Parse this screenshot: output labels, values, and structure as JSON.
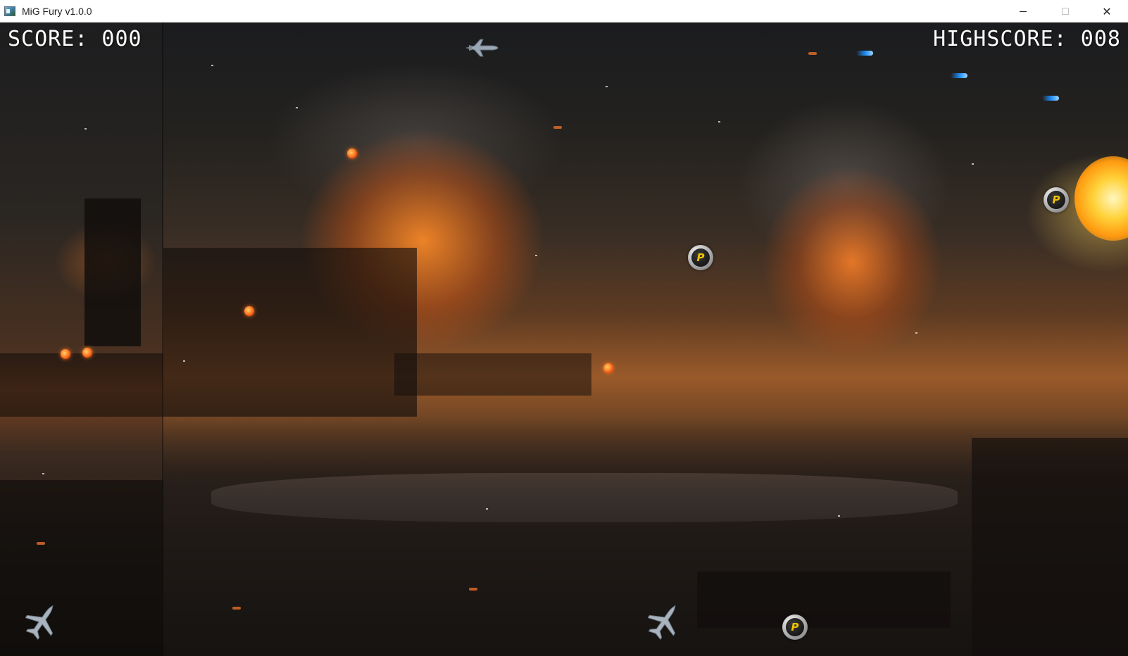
{
  "window": {
    "title": "MiG Fury v1.0.0",
    "controls": {
      "minimize": "minimize",
      "maximize": "maximize",
      "close": "✕"
    }
  },
  "hud": {
    "score": "SCORE: 000",
    "highscore": "HIGHSCORE: 008"
  },
  "sprites": {
    "player": "fighter-jet",
    "lives_icon": "fighter-jet",
    "lives_remaining": 2,
    "power_up_letter": "P",
    "power_up_count": 3,
    "enemy_bullet_count": 6,
    "missile_count": 3
  },
  "colors": {
    "hud_text": "#ffffff",
    "power_up_letter": "#f2c200",
    "enemy_bullet": "#ff6a1a",
    "missile": "#1e90ff"
  }
}
